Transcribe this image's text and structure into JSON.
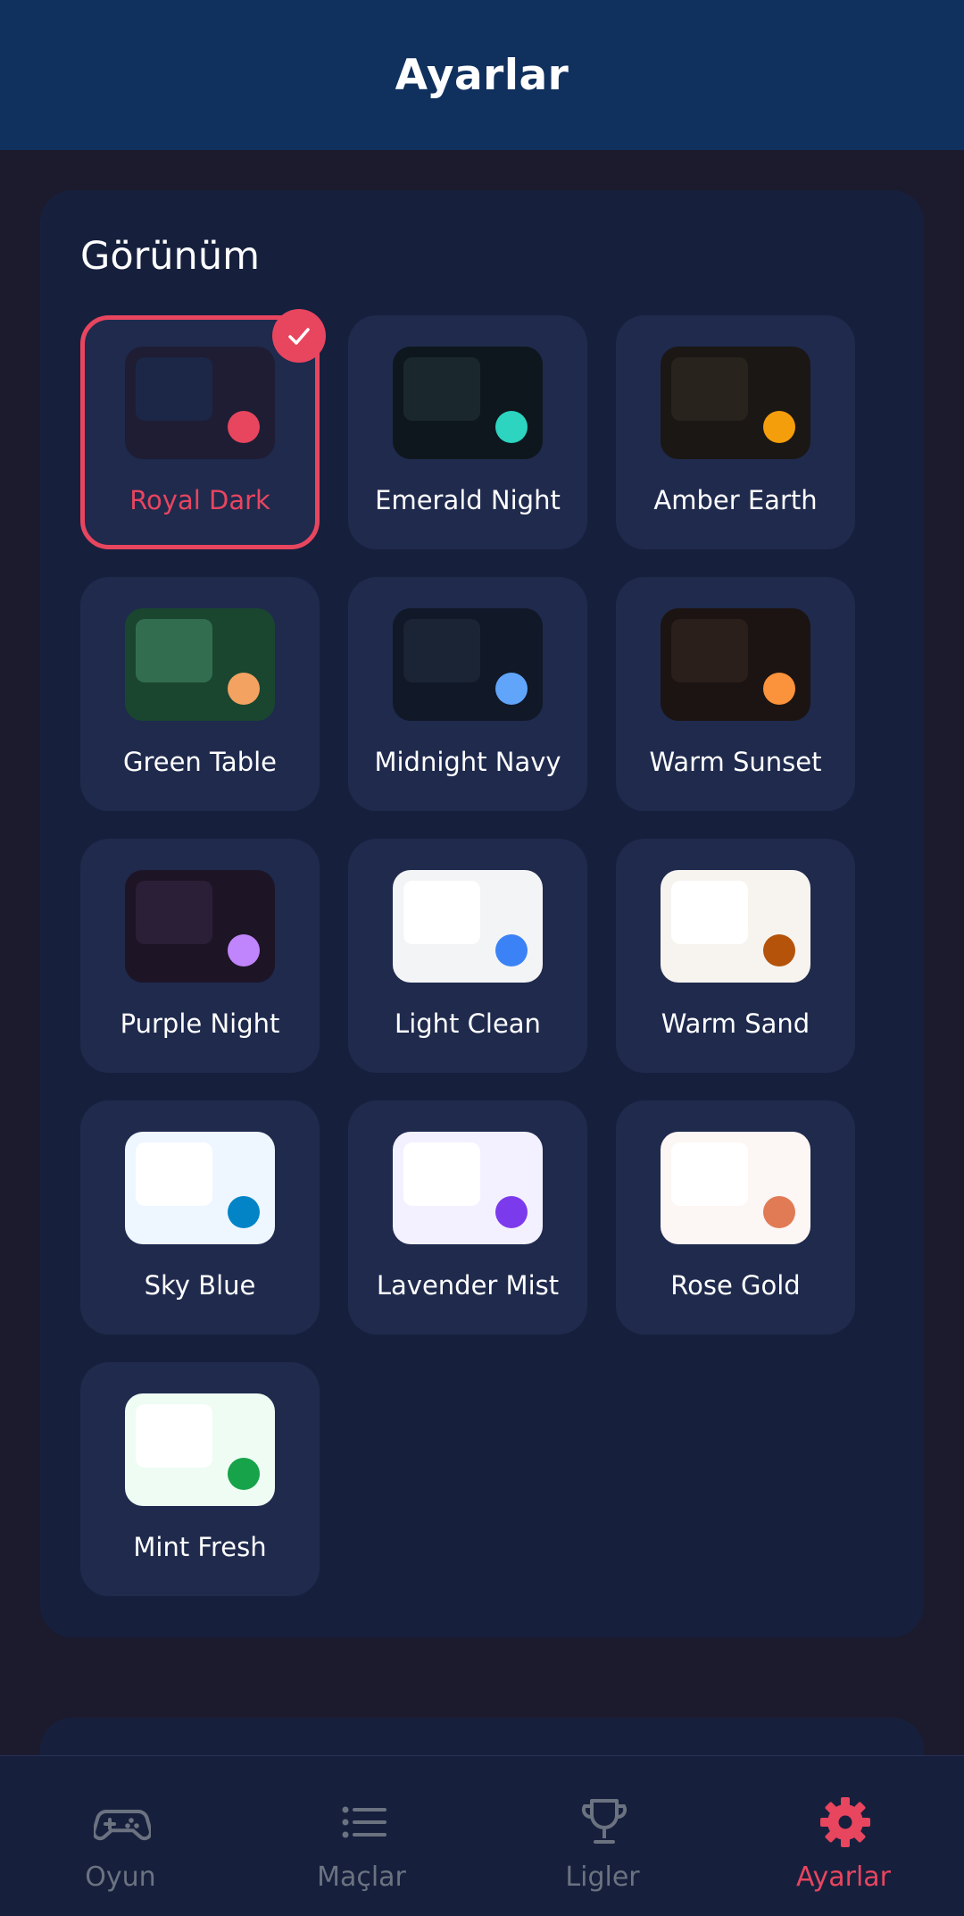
{
  "header": {
    "title": "Ayarlar"
  },
  "appearance": {
    "section_title": "Görünüm",
    "selected_index": 0,
    "themes": [
      {
        "label": "Royal Dark",
        "bg": "#1e1d33",
        "panel": "#1c2747",
        "dot": "#e8455f"
      },
      {
        "label": "Emerald Night",
        "bg": "#0e171d",
        "panel": "#1a282e",
        "dot": "#2dd4bf"
      },
      {
        "label": "Amber Earth",
        "bg": "#1b1714",
        "panel": "#28231d",
        "dot": "#f59e0b"
      },
      {
        "label": "Green Table",
        "bg": "#1a4630",
        "panel": "#336d4f",
        "dot": "#f4a261"
      },
      {
        "label": "Midnight Navy",
        "bg": "#111827",
        "panel": "#1b2434",
        "dot": "#60a5fa"
      },
      {
        "label": "Warm Sunset",
        "bg": "#1c1412",
        "panel": "#2b1f1b",
        "dot": "#fb923c"
      },
      {
        "label": "Purple Night",
        "bg": "#1d1526",
        "panel": "#2a1f36",
        "dot": "#c084fc"
      },
      {
        "label": "Light Clean",
        "bg": "#f3f4f6",
        "panel": "#ffffff",
        "dot": "#3b82f6"
      },
      {
        "label": "Warm Sand",
        "bg": "#f7f3ef",
        "panel": "#ffffff",
        "dot": "#b45309"
      },
      {
        "label": "Sky Blue",
        "bg": "#eef6ff",
        "panel": "#ffffff",
        "dot": "#0284c7"
      },
      {
        "label": "Lavender Mist",
        "bg": "#f3f1ff",
        "panel": "#ffffff",
        "dot": "#7c3aed"
      },
      {
        "label": "Rose Gold",
        "bg": "#fcf6f4",
        "panel": "#ffffff",
        "dot": "#e07b55"
      },
      {
        "label": "Mint Fresh",
        "bg": "#eefcf3",
        "panel": "#ffffff",
        "dot": "#16a34a"
      }
    ]
  },
  "bottom_nav": {
    "active_index": 3,
    "items": [
      {
        "label": "Oyun",
        "icon": "gamepad-icon"
      },
      {
        "label": "Maçlar",
        "icon": "list-icon"
      },
      {
        "label": "Ligler",
        "icon": "trophy-icon"
      },
      {
        "label": "Ayarlar",
        "icon": "gear-icon"
      }
    ]
  },
  "colors": {
    "accent": "#e8455f",
    "header_bg": "#10315e",
    "inactive": "#6b7280"
  }
}
